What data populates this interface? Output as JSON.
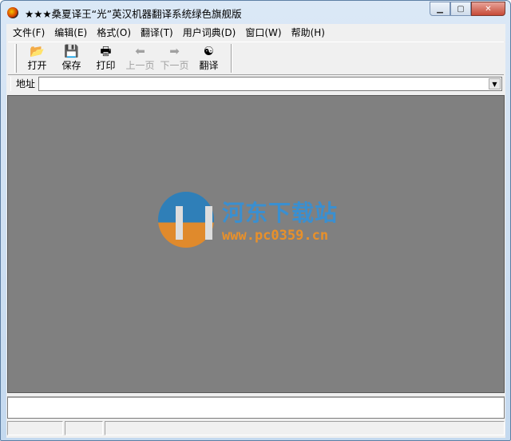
{
  "window": {
    "title": "★★★桑夏译王“光”英汉机器翻译系统绿色旗舰版"
  },
  "menu": [
    "文件(F)",
    "编辑(E)",
    "格式(O)",
    "翻译(T)",
    "用户词典(D)",
    "窗口(W)",
    "帮助(H)"
  ],
  "toolbar": {
    "open": "打开",
    "save": "保存",
    "print": "打印",
    "prev": "上一页",
    "next": "下一页",
    "translate": "翻译"
  },
  "address": {
    "label": "地址",
    "value": ""
  },
  "watermark": {
    "name": "河东下载站",
    "url": "www.pc0359.cn"
  }
}
